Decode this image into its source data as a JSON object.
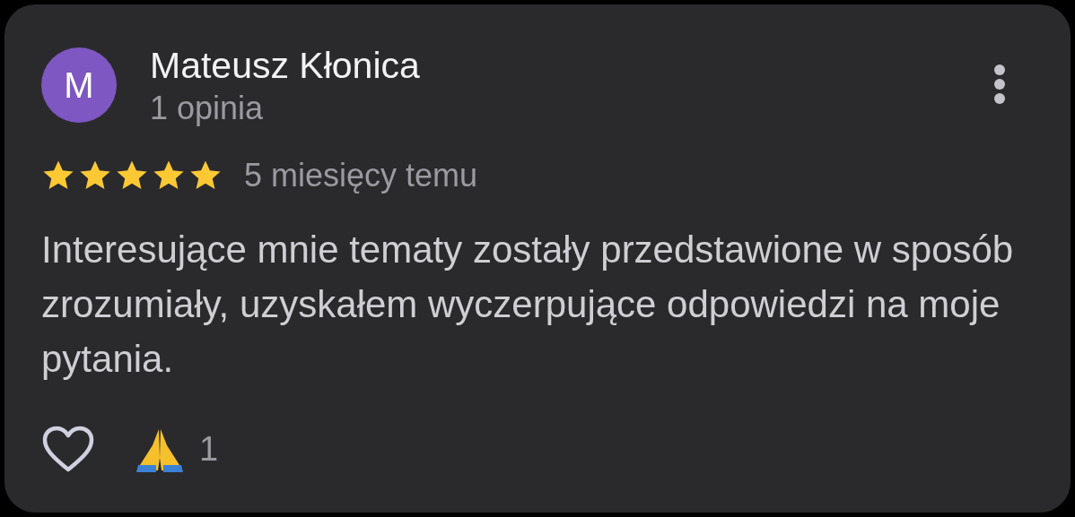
{
  "review": {
    "avatar_letter": "M",
    "author": "Mateusz Kłonica",
    "review_count": "1 opinia",
    "stars": 5,
    "time": "5 miesięcy temu",
    "text": "Interesujące mnie tematy zostały przedstawione w sposób zrozumiały, uzyskałem wyczerpujące odpowiedzi na moje pytania.",
    "reactions": [
      {
        "kind": "like"
      },
      {
        "kind": "pray",
        "count": "1"
      }
    ]
  }
}
